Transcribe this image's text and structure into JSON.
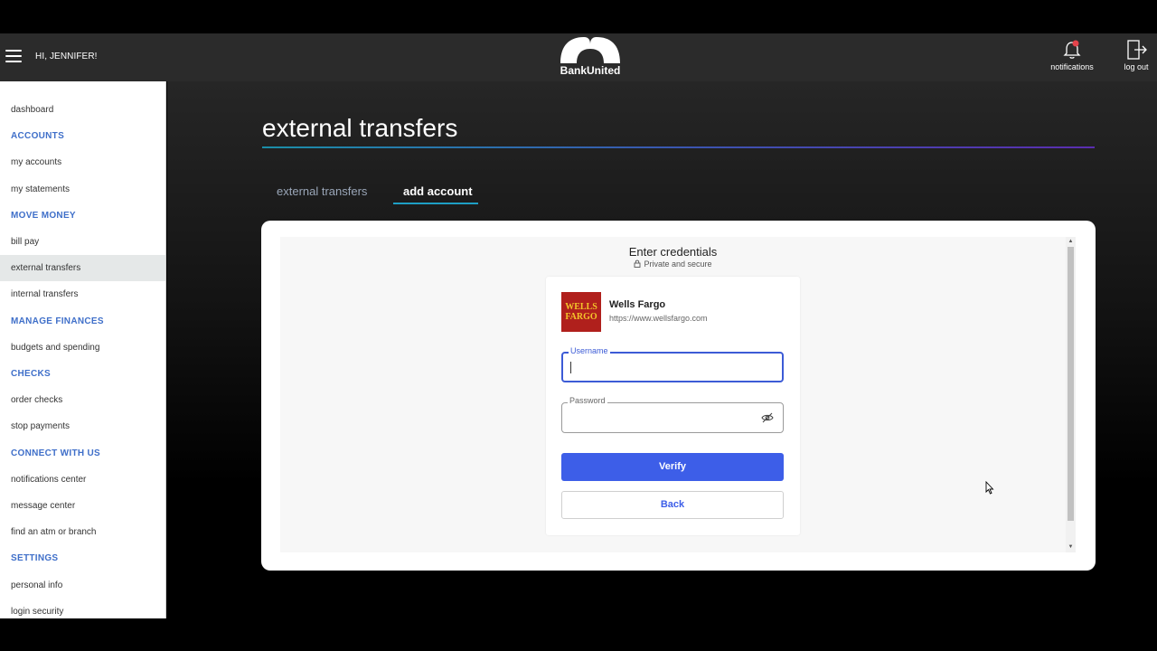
{
  "header": {
    "greeting": "HI, JENNIFER!",
    "logo_text": "BankUnited",
    "notifications_label": "notifications",
    "logout_label": "log out"
  },
  "sidebar": {
    "items": [
      {
        "type": "link",
        "label": "dashboard"
      },
      {
        "type": "heading",
        "label": "ACCOUNTS"
      },
      {
        "type": "link",
        "label": "my accounts"
      },
      {
        "type": "link",
        "label": "my statements"
      },
      {
        "type": "heading",
        "label": "MOVE MONEY"
      },
      {
        "type": "link",
        "label": "bill pay"
      },
      {
        "type": "link",
        "label": "external transfers",
        "active": true
      },
      {
        "type": "link",
        "label": "internal transfers"
      },
      {
        "type": "heading",
        "label": "MANAGE FINANCES"
      },
      {
        "type": "link",
        "label": "budgets and spending"
      },
      {
        "type": "heading",
        "label": "CHECKS"
      },
      {
        "type": "link",
        "label": "order checks"
      },
      {
        "type": "link",
        "label": "stop payments"
      },
      {
        "type": "heading",
        "label": "CONNECT WITH US"
      },
      {
        "type": "link",
        "label": "notifications center"
      },
      {
        "type": "link",
        "label": "message center"
      },
      {
        "type": "link",
        "label": "find an atm or branch"
      },
      {
        "type": "heading",
        "label": "SETTINGS"
      },
      {
        "type": "link",
        "label": "personal info"
      },
      {
        "type": "link",
        "label": "login security"
      }
    ]
  },
  "main": {
    "title": "external transfers",
    "tabs": [
      {
        "label": "external transfers",
        "active": false
      },
      {
        "label": "add account",
        "active": true
      }
    ]
  },
  "credentials": {
    "title": "Enter credentials",
    "subtitle": "Private and secure",
    "bank": {
      "name": "Wells Fargo",
      "url": "https://www.wellsfargo.com",
      "logo_line1": "WELLS",
      "logo_line2": "FARGO"
    },
    "username": {
      "label": "Username",
      "value": ""
    },
    "password": {
      "label": "Password",
      "value": ""
    },
    "verify_label": "Verify",
    "back_label": "Back"
  },
  "colors": {
    "accent": "#3d5ee8",
    "section_heading": "#3f6fc9",
    "tab_underline": "#1e9fc4",
    "bank_logo_bg": "#b0201c"
  }
}
